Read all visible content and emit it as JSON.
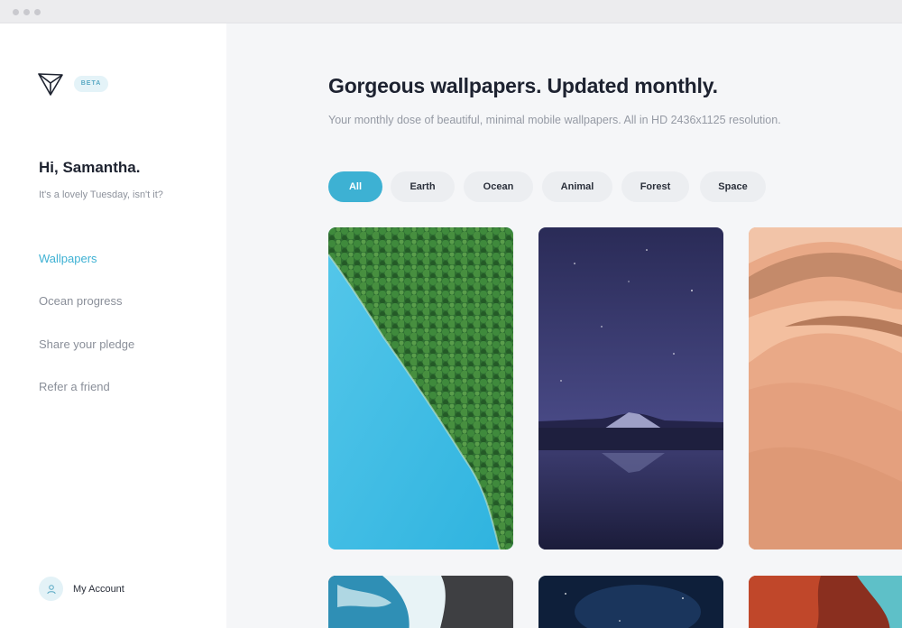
{
  "sidebar": {
    "badge": "BETA",
    "greeting": "Hi, Samantha.",
    "subgreeting": "It's a lovely Tuesday, isn't it?",
    "nav": [
      {
        "label": "Wallpapers",
        "active": true
      },
      {
        "label": "Ocean progress",
        "active": false
      },
      {
        "label": "Share your pledge",
        "active": false
      },
      {
        "label": "Refer a friend",
        "active": false
      }
    ],
    "account_label": "My Account"
  },
  "main": {
    "title": "Gorgeous wallpapers. Updated monthly.",
    "subtitle": "Your monthly dose of beautiful, minimal mobile wallpapers. All in HD 2436x1125 resolution.",
    "filters": [
      {
        "label": "All",
        "active": true
      },
      {
        "label": "Earth",
        "active": false
      },
      {
        "label": "Ocean",
        "active": false
      },
      {
        "label": "Animal",
        "active": false
      },
      {
        "label": "Forest",
        "active": false
      },
      {
        "label": "Space",
        "active": false
      }
    ],
    "wallpapers": [
      {
        "scene": "forest-coast"
      },
      {
        "scene": "night-mountain-lake"
      },
      {
        "scene": "desert-dunes"
      },
      {
        "scene": "ocean-waves"
      },
      {
        "scene": "starry-sky"
      },
      {
        "scene": "red-canyon"
      }
    ]
  },
  "colors": {
    "accent": "#3db1d3",
    "sidebar_bg": "#ffffff",
    "main_bg": "#f5f6f8"
  }
}
